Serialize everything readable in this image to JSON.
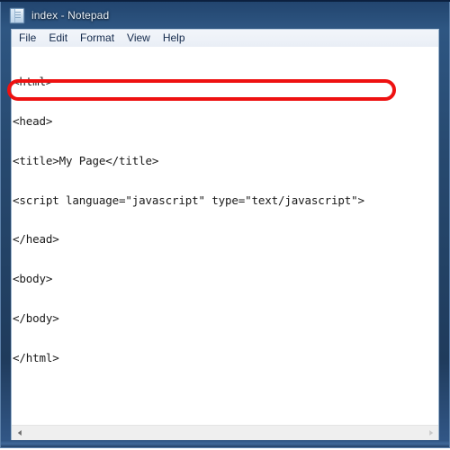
{
  "window": {
    "title": "index - Notepad",
    "icon": "notepad-document-icon",
    "frame_color": "#27496f",
    "titlebar_text_color": "#e8f0f8"
  },
  "menubar": {
    "items": [
      {
        "label": "File"
      },
      {
        "label": "Edit"
      },
      {
        "label": "Format"
      },
      {
        "label": "View"
      },
      {
        "label": "Help"
      }
    ]
  },
  "editor": {
    "lines": [
      "<html>",
      "<head>",
      "<title>My Page</title>",
      "<script language=\"javascript\" type=\"text/javascript\">",
      "</head>",
      "<body>",
      "</body>",
      "</html>"
    ],
    "text_color": "#1a1a1a",
    "background": "#ffffff"
  },
  "annotation": {
    "type": "rounded-rectangle-highlight",
    "color": "#ee1111",
    "targets_line_index": 3,
    "targets_line_text": "<script language=\"javascript\" type=\"text/javascript\">"
  },
  "scrollbar": {
    "orientation": "horizontal",
    "left_arrow": "◀",
    "right_arrow": "▶",
    "track_color": "#efefef"
  }
}
